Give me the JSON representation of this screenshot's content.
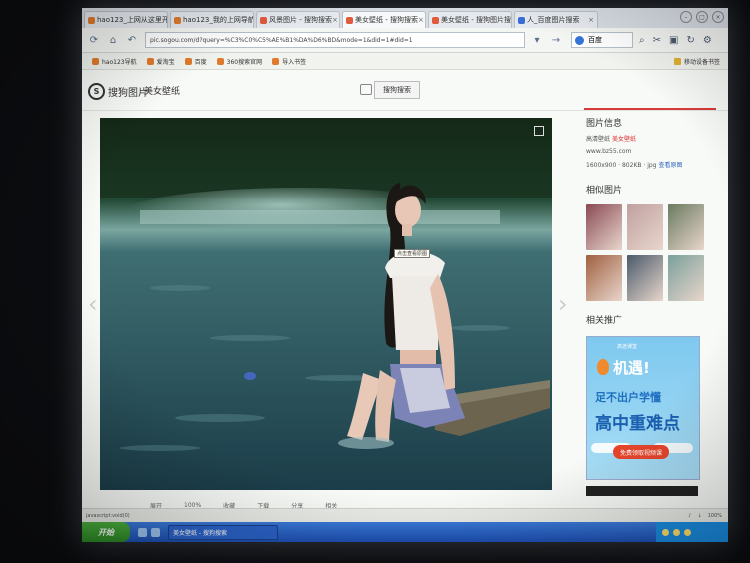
{
  "tabs": [
    {
      "label": "hao123_上网从这里开始",
      "color": "#e07a2c",
      "active": false
    },
    {
      "label": "hao123_我的上网导航",
      "color": "#e07a2c",
      "active": false
    },
    {
      "label": "风景图片 - 搜狗搜索",
      "color": "#e05a3c",
      "active": false
    },
    {
      "label": "美女壁纸 - 搜狗搜索",
      "color": "#e05a3c",
      "active": true
    },
    {
      "label": "美女壁纸 - 搜狗图片搜索",
      "color": "#e05a3c",
      "active": false
    },
    {
      "label": "人_百度图片搜索",
      "color": "#3a6fd8",
      "active": false
    }
  ],
  "nav": {
    "address": "pic.sogou.com/d?query=%C3%C0%C5%AE%B1%DA%D6%BD&mode=1&did=1#did=1",
    "search_value": "百度"
  },
  "bookmarks": [
    "hao123导航",
    "爱淘宝",
    "百度",
    "360搜索官网",
    "导入书签"
  ],
  "bookmarks_right": "移动设备书签",
  "sogou": {
    "logo_text": "搜狗图片",
    "query": "美女壁纸",
    "search_button": "搜狗搜索"
  },
  "viewer": {
    "hint": "点击查看原图"
  },
  "bottom_actions": [
    "展开",
    "100%",
    "收藏",
    "下载",
    "分享",
    "相关"
  ],
  "sidebar": {
    "info_title": "图片信息",
    "source_prefix": "高清壁纸",
    "source_link": "美女壁纸",
    "site": "www.bz55.com",
    "dimensions": "1600x900 · 802KB · jpg",
    "view_original": "查看原图",
    "similar_title": "相似图片",
    "promo_title": "相关推广",
    "thumb_colors": [
      "#8a4a55",
      "#c0a0a0",
      "#6a7a60",
      "#a06040",
      "#4a5a6a",
      "#7aa09a"
    ]
  },
  "ad": {
    "small": "高途课堂",
    "line1": "机遇!",
    "line2": "足不出户学懂",
    "line3": "高中重难点",
    "button": "免费领取视频课"
  },
  "status": {
    "left": "javascript:void(0)",
    "zoom": "100%"
  },
  "taskbar": {
    "start": "开始",
    "task": "美女壁纸 - 搜狗搜索"
  }
}
